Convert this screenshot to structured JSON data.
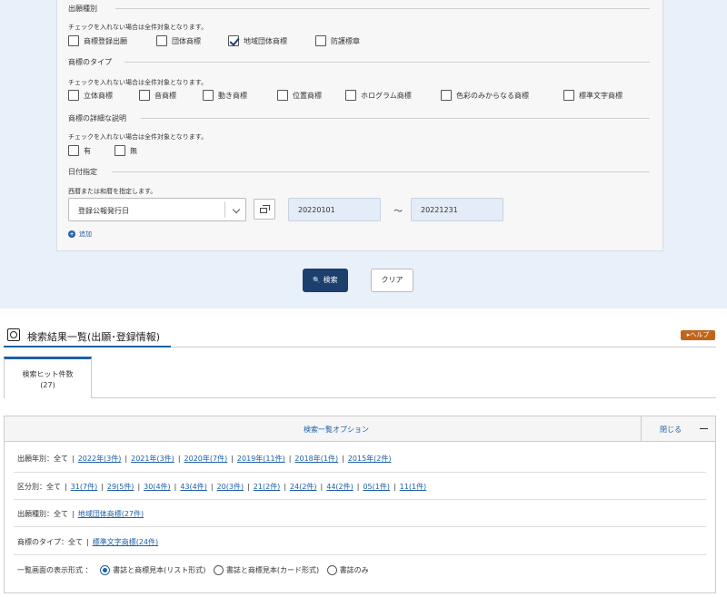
{
  "search_form": {
    "app_type": {
      "title": "出願種別",
      "note": "チェックを入れない場合は全件対象となります。",
      "options": [
        {
          "label": "商標登録出願",
          "checked": false
        },
        {
          "label": "団体商標",
          "checked": false
        },
        {
          "label": "地域団体商標",
          "checked": true
        },
        {
          "label": "防護標章",
          "checked": false
        }
      ]
    },
    "mark_type": {
      "title": "商標のタイプ",
      "note": "チェックを入れない場合は全件対象となります。",
      "options": [
        {
          "label": "立体商標",
          "checked": false
        },
        {
          "label": "音商標",
          "checked": false
        },
        {
          "label": "動き商標",
          "checked": false
        },
        {
          "label": "位置商標",
          "checked": false
        },
        {
          "label": "ホログラム商標",
          "checked": false
        },
        {
          "label": "色彩のみからなる商標",
          "checked": false
        },
        {
          "label": "標準文字商標",
          "checked": false
        }
      ]
    },
    "detail_desc": {
      "title": "商標の詳細な説明",
      "note": "チェックを入れない場合は全件対象となります。",
      "options": [
        {
          "label": "有",
          "checked": false
        },
        {
          "label": "無",
          "checked": false
        }
      ]
    },
    "date": {
      "title": "日付指定",
      "note": "西暦または和暦を指定します。",
      "select_value": "登録公報発行日",
      "from": "20220101",
      "tilde": "〜",
      "to": "20221231",
      "add_label": "追加",
      "add_icon": "+"
    },
    "search_button": "検索",
    "search_icon": "🔍",
    "clear_button": "クリア"
  },
  "results": {
    "title": "検索結果一覧(出願･登録情報)",
    "help_label": "▸ヘルプ",
    "tab": {
      "label": "検索ヒット件数",
      "count": "(27)"
    },
    "options": {
      "header": "検索一覧オプション",
      "close_label": "閉じる",
      "year_row": {
        "prefix": "出願年別：全て",
        "links": [
          "2022年(3件)",
          "2021年(3件)",
          "2020年(7件)",
          "2019年(11件)",
          "2018年(1件)",
          "2015年(2件)"
        ]
      },
      "class_row": {
        "prefix": "区分別：全て",
        "links": [
          "31(7件)",
          "29(5件)",
          "30(4件)",
          "43(4件)",
          "20(3件)",
          "21(2件)",
          "24(2件)",
          "44(2件)",
          "05(1件)",
          "11(1件)"
        ]
      },
      "kind_row": {
        "prefix": "出願種別：全て",
        "links": [
          "地域団体商標(27件)"
        ]
      },
      "type_row": {
        "prefix": "商標のタイプ：全て",
        "links": [
          "標準文字商標(24件)"
        ]
      },
      "display_row": {
        "prefix": "一覧画面の表示形式 ：",
        "radios": [
          {
            "label": "書誌と商標見本(リスト形式)",
            "selected": true
          },
          {
            "label": "書誌と商標見本(カード形式)",
            "selected": false
          },
          {
            "label": "書誌のみ",
            "selected": false
          }
        ]
      }
    }
  }
}
